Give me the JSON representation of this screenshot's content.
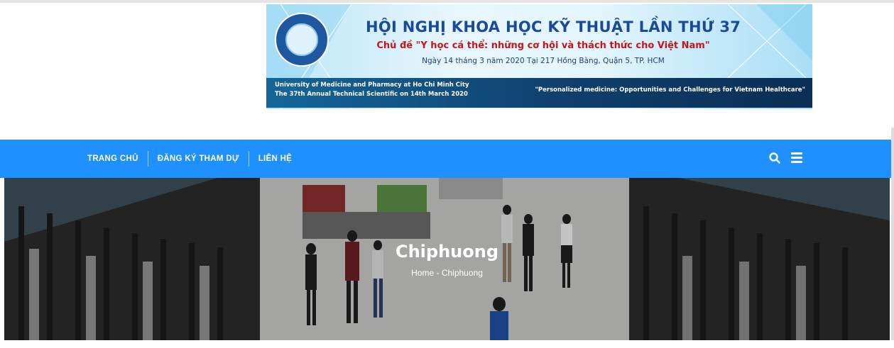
{
  "banner": {
    "title": "HỘI NGHỊ KHOA HỌC KỸ THUẬT LẦN THỨ 37",
    "theme": "Chủ đề \"Y học cá thể: những cơ hội và thách thức cho Việt Nam\"",
    "date": "Ngày 14 tháng 3 năm 2020 Tại 217 Hồng Bàng, Quận 5, TP. HCM",
    "university_line1": "University of Medicine and Pharmacy at Ho Chi Minh City",
    "university_line2": "The 37th Annual Technical Scientific on 14th March 2020",
    "slogan": "\"Personalized medicine: Opportunities and Challenges for Vietnam Healthcare\""
  },
  "nav": {
    "items": [
      {
        "label": "TRANG CHỦ"
      },
      {
        "label": "ĐĂNG KÝ THAM DỰ"
      },
      {
        "label": "LIÊN HỆ"
      }
    ],
    "search_icon": "search-icon",
    "menu_icon": "hamburger-menu-icon"
  },
  "hero": {
    "title": "Chiphuong",
    "breadcrumb_home": "Home",
    "breadcrumb_separator": " - ",
    "breadcrumb_current": "Chiphuong"
  },
  "colors": {
    "nav_background": "#1e90ff",
    "banner_title": "#1a4a9c",
    "banner_theme": "#c4161c"
  }
}
